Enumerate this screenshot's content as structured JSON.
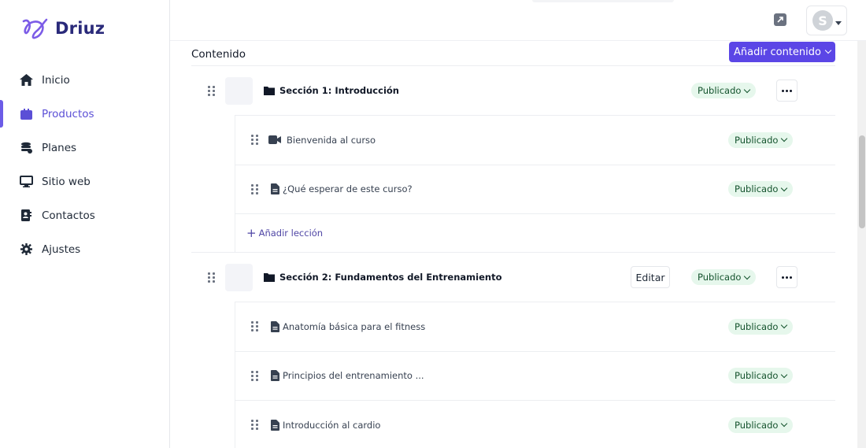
{
  "app": {
    "name": "Driuz",
    "brand_color": "#5b46e6",
    "accent_color": "#6c5ce7"
  },
  "sidebar": {
    "items": [
      {
        "label": "Inicio",
        "icon": "home-icon",
        "active": false
      },
      {
        "label": "Productos",
        "icon": "box-icon",
        "active": true
      },
      {
        "label": "Planes",
        "icon": "coins-icon",
        "active": false
      },
      {
        "label": "Sitio web",
        "icon": "monitor-icon",
        "active": false
      },
      {
        "label": "Contactos",
        "icon": "address-book-icon",
        "active": false
      },
      {
        "label": "Ajustes",
        "icon": "gear-icon",
        "active": false
      }
    ]
  },
  "header": {
    "avatar_initial": "S",
    "external_icon": "external-link-icon"
  },
  "main": {
    "title": "Contenido",
    "add_content_label": "Añadir contenido",
    "add_lesson_label": "Añadir lección",
    "edit_label": "Editar",
    "status_color": "#e6f7ec",
    "sections": [
      {
        "title": "Sección 1: Introducción",
        "status": "Publicado",
        "lessons": [
          {
            "title": "Bienvenida al curso",
            "type": "video-icon",
            "status": "Publicado"
          },
          {
            "title": "¿Qué esperar de este curso?",
            "type": "document-icon",
            "status": "Publicado"
          }
        ]
      },
      {
        "title": "Sección 2: Fundamentos del Entrenamiento",
        "status": "Publicado",
        "lessons": [
          {
            "title": "Anatomía básica para el fitness",
            "type": "document-icon",
            "status": "Publicado"
          },
          {
            "title": "Principios del entrenamiento ...",
            "type": "document-icon",
            "status": "Publicado"
          },
          {
            "title": "Introducción al cardio",
            "type": "document-icon",
            "status": "Publicado"
          }
        ]
      }
    ]
  }
}
